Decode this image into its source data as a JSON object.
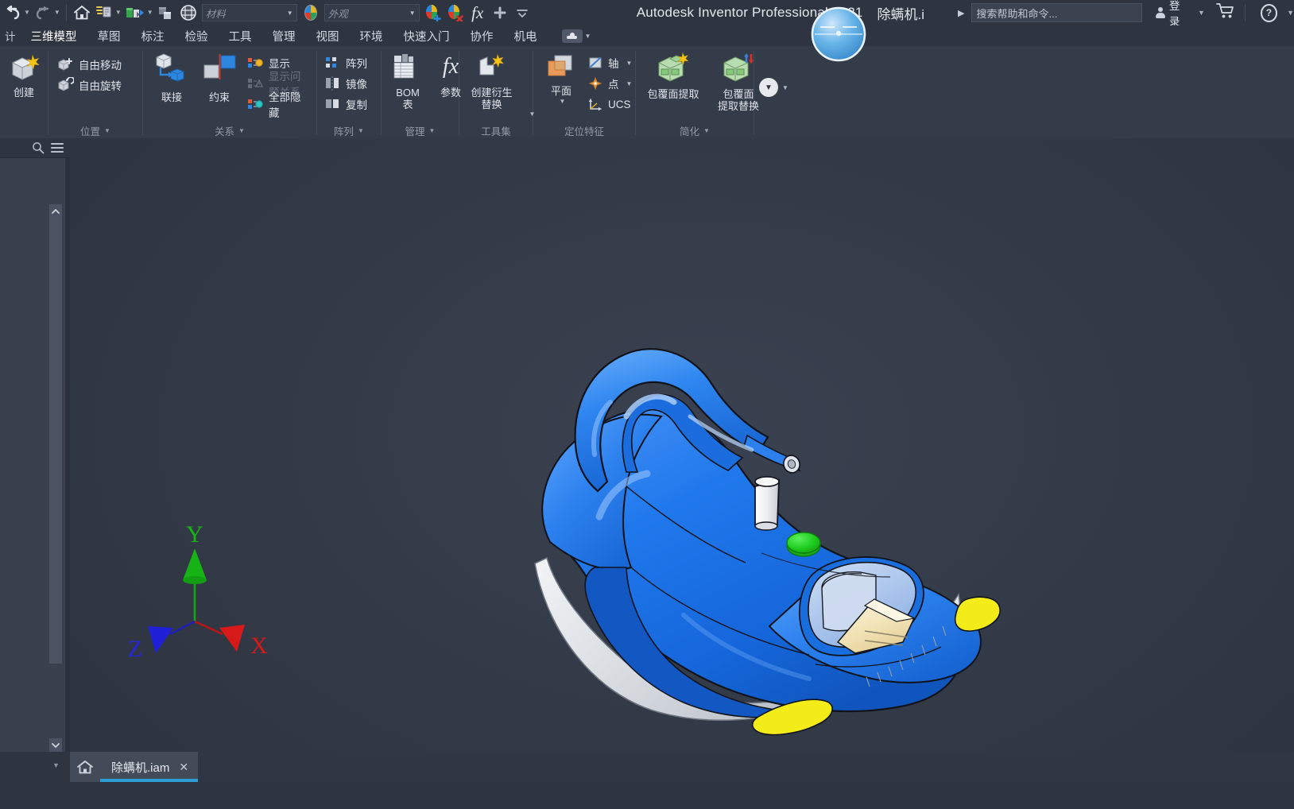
{
  "window": {
    "app_title": "Autodesk Inventor Professional 2021",
    "document_title": "除螨机.i",
    "title_caret": "▶"
  },
  "quick_access": {
    "undo_label": "撤消",
    "redo_label": "重做",
    "home_label": "返回",
    "update_label": "更新",
    "material_picker_label": "材质球",
    "appearance_sphere_label": "外观球",
    "clear_overrides_label": "清除替代",
    "material_combo": {
      "placeholder": "材料",
      "value": "材料",
      "caret": "▼"
    },
    "appearance_combo": {
      "placeholder": "外观",
      "value": "外观",
      "caret": "▼"
    },
    "adjust_label": "调整",
    "clear_label": "清除",
    "fx_label": "fx",
    "plus_label": "+",
    "more_label": "≡"
  },
  "titlebar_right": {
    "search_placeholder": "搜索帮助和命令...",
    "signin_label": "登录",
    "caret": "▼",
    "cart_label": "购物车",
    "help_label": "?"
  },
  "ribbon_tabs": {
    "prefix": "计",
    "items": [
      {
        "label": "三维模型",
        "active": true
      },
      {
        "label": "草图",
        "active": false
      },
      {
        "label": "标注",
        "active": false
      },
      {
        "label": "检验",
        "active": false
      },
      {
        "label": "工具",
        "active": false
      },
      {
        "label": "管理",
        "active": false
      },
      {
        "label": "视图",
        "active": false
      },
      {
        "label": "环境",
        "active": false
      },
      {
        "label": "快速入门",
        "active": false
      },
      {
        "label": "协作",
        "active": false
      },
      {
        "label": "机电",
        "active": false
      }
    ],
    "cloud_button_caret": "▼"
  },
  "ribbon_panels": [
    {
      "title": "",
      "has_dropdown": false,
      "big_buttons": [
        {
          "label": "创建",
          "icon": "create-component-icon"
        }
      ],
      "small_buttons": []
    },
    {
      "title": "位置",
      "has_dropdown": true,
      "big_buttons": [],
      "small_buttons": [
        {
          "label": "自由移动",
          "icon": "free-move-icon",
          "disabled": false
        },
        {
          "label": "自由旋转",
          "icon": "free-rotate-icon",
          "disabled": false
        }
      ]
    },
    {
      "title": "关系",
      "has_dropdown": true,
      "big_buttons": [
        {
          "label": "联接",
          "icon": "joint-icon"
        },
        {
          "label": "约束",
          "icon": "constrain-icon"
        }
      ],
      "small_buttons": [
        {
          "label": "显示",
          "icon": "show-relations-icon",
          "disabled": false
        },
        {
          "label": "显示问题关系",
          "icon": "show-sick-relations-icon",
          "disabled": true
        },
        {
          "label": "全部隐藏",
          "icon": "hide-all-icon",
          "disabled": false
        }
      ]
    },
    {
      "title": "阵列",
      "has_dropdown": true,
      "big_buttons": [],
      "small_buttons": [
        {
          "label": "阵列",
          "icon": "pattern-icon",
          "disabled": false
        },
        {
          "label": "镜像",
          "icon": "mirror-icon",
          "disabled": false
        },
        {
          "label": "复制",
          "icon": "copy-icon",
          "disabled": false
        }
      ]
    },
    {
      "title": "管理",
      "has_dropdown": true,
      "big_buttons": [
        {
          "label": "BOM\n表",
          "icon": "bom-table-icon"
        },
        {
          "label": "参数",
          "icon": "parameters-fx-icon"
        }
      ],
      "small_buttons": []
    },
    {
      "title": "工具集",
      "has_dropdown": false,
      "big_buttons": [
        {
          "label": "创建衍生\n替换",
          "icon": "create-substitute-icon",
          "caret": "▼"
        }
      ],
      "small_buttons": []
    },
    {
      "title": "定位特征",
      "has_dropdown": false,
      "big_buttons": [
        {
          "label": "平面",
          "icon": "work-plane-icon",
          "caret": "▼"
        }
      ],
      "small_buttons": [
        {
          "label": "轴",
          "icon": "work-axis-icon",
          "caret": "▼",
          "disabled": false
        },
        {
          "label": "点",
          "icon": "work-point-icon",
          "caret": "▼",
          "disabled": false
        },
        {
          "label": "UCS",
          "icon": "ucs-icon",
          "disabled": false
        }
      ]
    },
    {
      "title": "简化",
      "has_dropdown": true,
      "big_buttons": [
        {
          "label": "包覆面提取",
          "icon": "shrinkwrap-icon"
        },
        {
          "label": "包覆面\n提取替换",
          "icon": "shrinkwrap-substitute-icon"
        }
      ],
      "small_buttons": []
    }
  ],
  "ribbon_overflow": {
    "label": "更多",
    "caret": "▼"
  },
  "browser": {
    "search_icon_label": "search-icon",
    "menu_icon_label": "hamburger-menu-icon",
    "scroll_up": "▲",
    "scroll_down": "▼"
  },
  "viewport": {
    "axis": {
      "x_label": "X",
      "y_label": "Y",
      "z_label": "Z",
      "x_color": "#d81919",
      "y_color": "#16b216",
      "z_color": "#2020d8"
    },
    "model": {
      "name": "除螨机",
      "body_color": "#1f74e8",
      "body_highlight": "#5aa0f5",
      "accent_color": "#f6ee19",
      "button_color": "#1fcc1f",
      "nozzle_color": "#e8eaec",
      "filter_color": "#f2e4b8",
      "container_color": "#c9d8ee",
      "sole_color": "#d6d9de",
      "outline_color": "#111318"
    },
    "background_color": "#343b49"
  },
  "bottom_tabs": {
    "home_icon_label": "home-icon",
    "caret": "▼",
    "documents": [
      {
        "label": "除螨机.iam",
        "close": "✕",
        "active": true
      }
    ]
  }
}
